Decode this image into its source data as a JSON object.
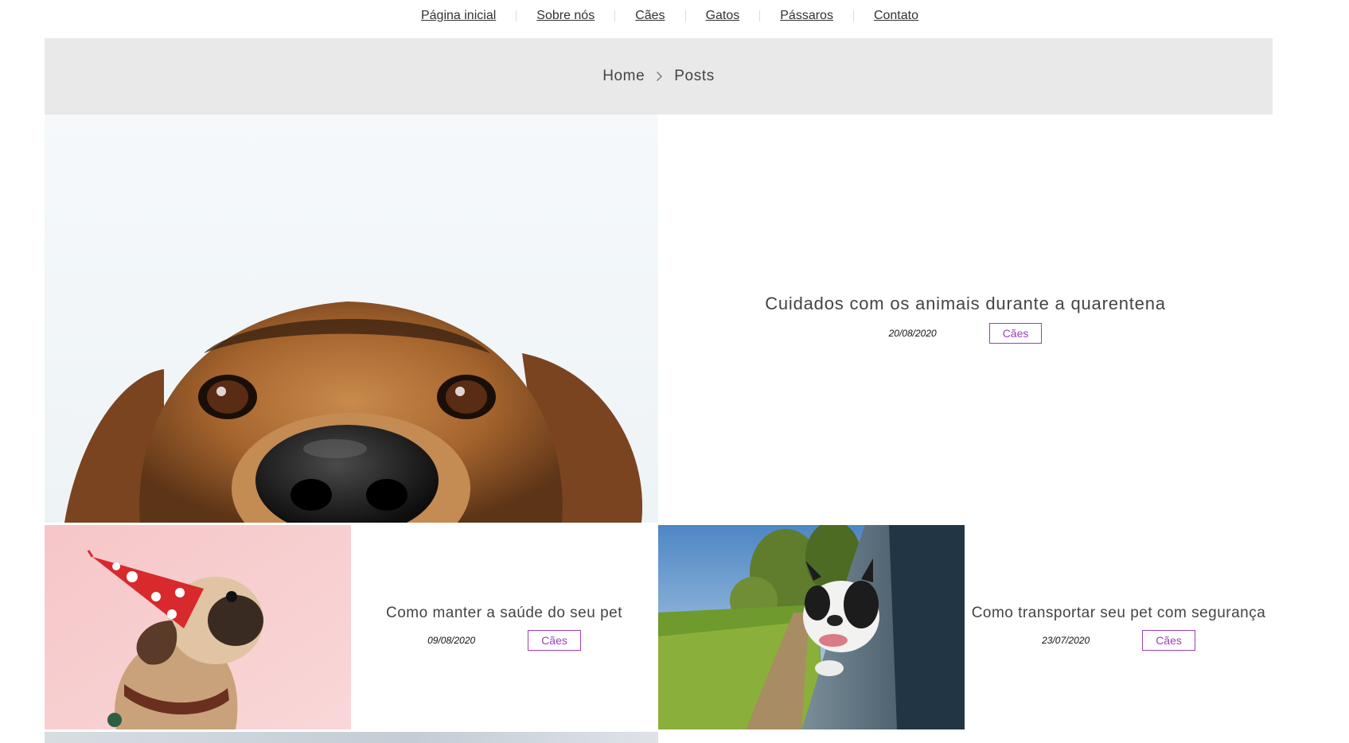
{
  "nav": {
    "items": [
      {
        "label": "Página inicial"
      },
      {
        "label": "Sobre nós"
      },
      {
        "label": "Cães"
      },
      {
        "label": "Gatos"
      },
      {
        "label": "Pássaros"
      },
      {
        "label": "Contato"
      }
    ]
  },
  "breadcrumb": {
    "home": "Home",
    "current": "Posts"
  },
  "posts": [
    {
      "title": "Cuidados com os animais durante a quarentena",
      "date": "20/08/2020",
      "tag": "Cães"
    },
    {
      "title": "Como manter a saúde do seu pet",
      "date": "09/08/2020",
      "tag": "Cães"
    },
    {
      "title": "Como transportar seu pet com segurança",
      "date": "23/07/2020",
      "tag": "Cães"
    }
  ],
  "colors": {
    "accent": "#9b3fb8",
    "breadcrumb_bg": "#e9e9e9"
  },
  "icons": {
    "breadcrumb_separator": "chevron-right-icon"
  }
}
